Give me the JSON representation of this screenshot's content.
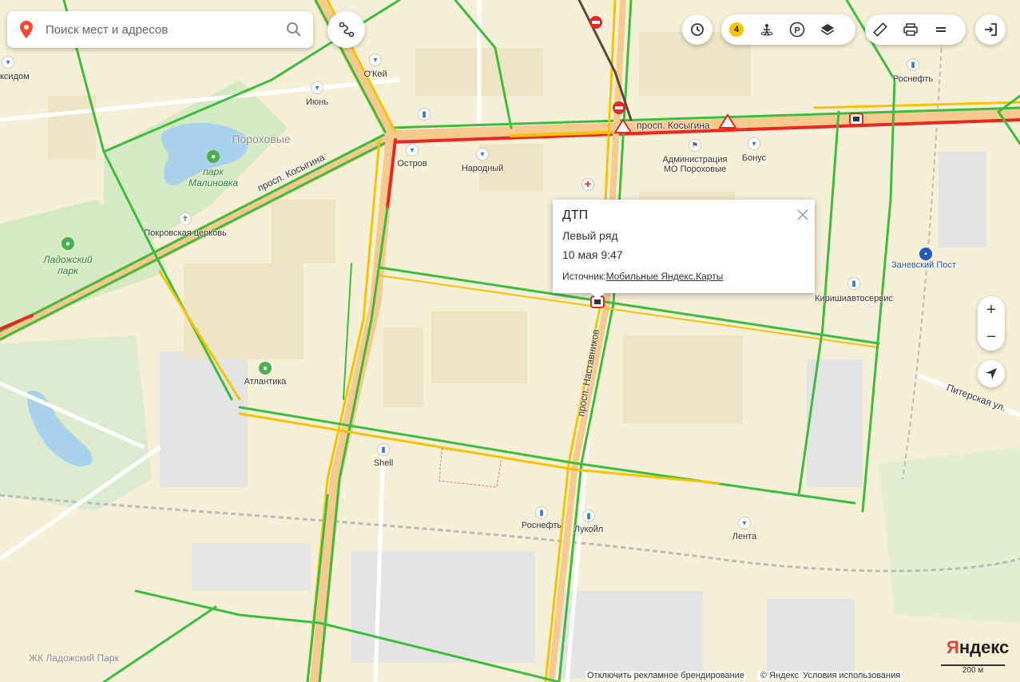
{
  "search": {
    "placeholder": "Поиск мест и адресов"
  },
  "toolbar": {
    "traffic_level": "4",
    "icons": [
      "history-icon",
      "traffic-icon",
      "panorama-icon",
      "parking-icon",
      "layers-icon",
      "ruler-icon",
      "print-icon",
      "menu-icon",
      "login-icon"
    ]
  },
  "zoom": {
    "in": "+",
    "out": "−"
  },
  "popup": {
    "title": "ДТП",
    "detail": "Левый ряд",
    "time": "10 мая 9:47",
    "source_label": "Источник:",
    "source_link": "Мобильные Яндекс.Карты"
  },
  "map_labels": {
    "street_kosygina_1": "просп. Косыгина",
    "street_kosygina_2": "просп. Косыгина",
    "street_nastavnikov": "просп. Наставников",
    "street_piterskaya": "Питерская ул.",
    "district": "Пороховые",
    "park_malinovka": "парк\nМалиновка",
    "park_ladozhsky": "Ладожский\nпарк",
    "zhk": "ЖК Ладожский Парк",
    "oxidom": "ксидом",
    "june": "Июнь",
    "okey": "О'Кей",
    "ostrov": "Остров",
    "narodny": "Народный",
    "admin": "Администрация\nМО Пороховые",
    "bonus": "Бонус",
    "rosneft_top": "Роснефть",
    "zanevsky": "Заневский Пост",
    "kirishi": "Киришиавтосервис",
    "pokrovsky": "Покровская церковь",
    "atlantika": "Атлантика",
    "shell": "Shell",
    "rosneft_bottom": "Роснефть",
    "lukoil": "Лукойл",
    "lenta": "Лента"
  },
  "footer": {
    "disable_ads": "Отключить рекламное брендирование",
    "copyright": "© Яндекс",
    "terms": "Условия использования"
  },
  "logo": {
    "first": "Я",
    "rest": "ндекс"
  },
  "scale": {
    "label": "200 м"
  },
  "colors": {
    "traffic_green": "#3cbd3c",
    "traffic_yellow": "#f5c400",
    "traffic_red": "#e8271e",
    "road_fill": "#f6c98f",
    "map_bg": "#f5efd8",
    "park": "#d4e9c4",
    "water": "#a8d1ea"
  }
}
